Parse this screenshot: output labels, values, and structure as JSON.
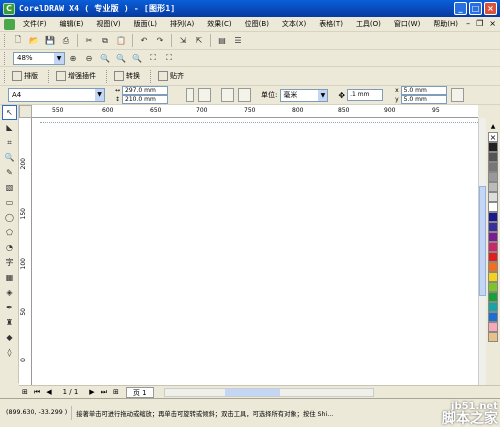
{
  "window": {
    "title": "CorelDRAW X4 ( 专业版 ) - [图形1]",
    "buttons": [
      "_",
      "□",
      "×"
    ]
  },
  "menubar": {
    "items": [
      "文件(F)",
      "编辑(E)",
      "视图(V)",
      "版面(L)",
      "排列(A)",
      "效果(C)",
      "位图(B)",
      "文本(X)",
      "表格(T)",
      "工具(O)",
      "窗口(W)",
      "帮助(H)"
    ]
  },
  "zoom": {
    "value": "48%"
  },
  "toolbar3": {
    "buttons": [
      "排版",
      "增强插件",
      "转换",
      "贴齐"
    ]
  },
  "property_bar": {
    "page_size": "A4",
    "width": "297.0 mm",
    "height": "210.0 mm",
    "unit_label": "单位:",
    "unit": "毫米",
    "nudge": ".1 mm",
    "dup_x": "5.0 mm",
    "dup_y": "5.0 mm"
  },
  "ruler": {
    "h_ticks": [
      "550",
      "600",
      "650",
      "700",
      "750",
      "800",
      "850",
      "900",
      "95"
    ],
    "v_ticks": [
      "200",
      "150",
      "100",
      "50",
      "0"
    ]
  },
  "palette": {
    "colors": [
      "#222222",
      "#555555",
      "#777777",
      "#999999",
      "#bbbbbb",
      "#dddddd",
      "#ffffff",
      "#1a1a8c",
      "#3b2f9a",
      "#7a1f8f",
      "#c8286a",
      "#e01e1e",
      "#f07020",
      "#f5d21a",
      "#7cc42a",
      "#1a9e3a",
      "#1aa3a3",
      "#1a6fd0",
      "#f7a8b8",
      "#e8c08a"
    ]
  },
  "pagebar": {
    "count": "1 / 1",
    "tab": "页 1"
  },
  "status": {
    "coords": "(899.630, -33.299 )",
    "message": "接著单击可进行拖动或缩放；再单击可旋转或倾斜；双击工具，可选择所有对象；按住 Shi..."
  },
  "watermark": {
    "url": "jb51.net",
    "text": "脚本之家"
  }
}
